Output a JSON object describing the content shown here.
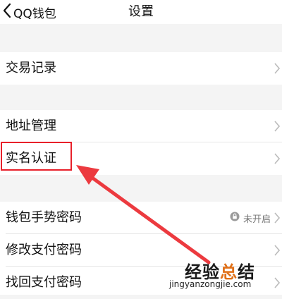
{
  "nav": {
    "back_label": "QQ钱包",
    "title": "设置"
  },
  "rows": {
    "transactions": {
      "label": "交易记录"
    },
    "address": {
      "label": "地址管理"
    },
    "realname": {
      "label": "实名认证"
    },
    "gesture": {
      "label": "钱包手势密码",
      "status": "未开启"
    },
    "change_pay_pw": {
      "label": "修改支付密码"
    },
    "recover_pay_pw": {
      "label": "找回支付密码"
    }
  },
  "watermark": {
    "main_part1": "经验",
    "main_part2": "总",
    "main_part3": "结",
    "sub": "jingyanzongjie.com"
  },
  "colors": {
    "highlight": "#e8202a",
    "background": "#f4f4f4",
    "row_bg": "#ffffff"
  },
  "icons": {
    "back": "chevron-left-icon",
    "row_arrow": "chevron-right-icon",
    "lock": "lock-icon"
  }
}
